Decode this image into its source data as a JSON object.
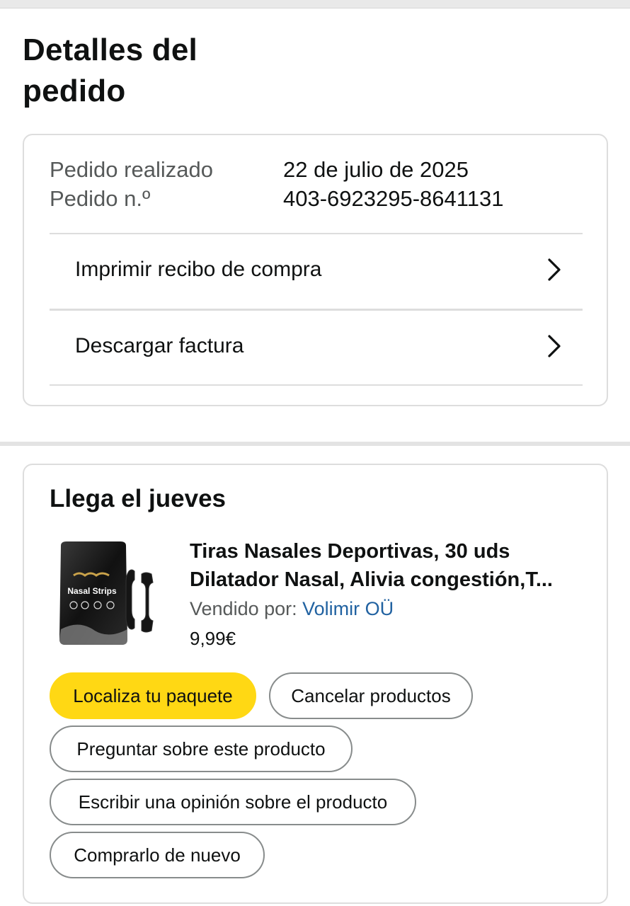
{
  "page": {
    "title": "Detalles del pedido"
  },
  "order": {
    "placed_label": "Pedido realizado",
    "placed_value": "22 de julio de 2025",
    "number_label": "Pedido n.º",
    "number_value": "403-6923295-8641131",
    "actions": [
      {
        "label": "Imprimir recibo de compra",
        "icon": "chevron-right-icon"
      },
      {
        "label": "Descargar factura",
        "icon": "chevron-right-icon"
      }
    ]
  },
  "shipment": {
    "title": "Llega el jueves",
    "product": {
      "title_line1": "Tiras Nasales Deportivas, 30 uds",
      "title_line2": "Dilatador Nasal, Alivia congestión,T...",
      "sold_by_label": "Vendido por:",
      "seller": "Volimir OÜ",
      "price": "9,99€",
      "image_text": "Nasal Strips"
    },
    "buttons": {
      "track": "Localiza tu paquete",
      "cancel": "Cancelar productos",
      "ask": "Preguntar sobre este producto",
      "review": "Escribir una opinión sobre el producto",
      "buy_again": "Comprarlo de nuevo"
    }
  },
  "colors": {
    "primary_button": "#ffd814",
    "link": "#2162a1",
    "muted_text": "#565959",
    "border": "#dddddd"
  }
}
